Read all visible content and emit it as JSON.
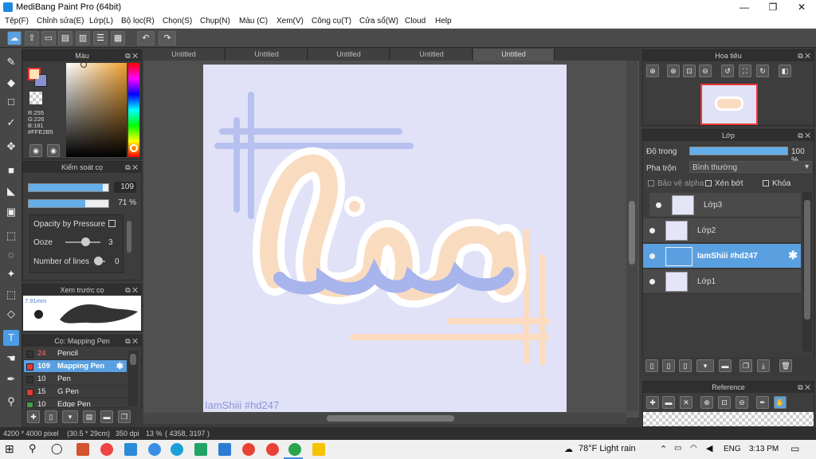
{
  "window": {
    "title": "MediBang Paint Pro (64bit)",
    "min": "—",
    "max": "❐",
    "close": "✕"
  },
  "menu": [
    "Tệp(F)",
    "Chỉnh sửa(E)",
    "Lớp(L)",
    "Bộ lọc(R)",
    "Chọn(S)",
    "Chụp(N)",
    "Màu (C)",
    "Xem(V)",
    "Công cụ(T)",
    "Cửa sổ(W)",
    "Cloud",
    "Help"
  ],
  "tabs": [
    "Untitled",
    "Untitled",
    "Untitled",
    "Untitled",
    "Untitled"
  ],
  "color_panel": {
    "title": "Màu",
    "r": "R:255",
    "g": "G:226",
    "b": "B:181",
    "hex": "#FFE2B5",
    "fg_color": "#ffe2b5",
    "bg_color": "#8a8fd0"
  },
  "brush_control": {
    "title": "Kiểm soát cọ",
    "size_value": "109",
    "opacity_value": "71 %",
    "size_level": 0.93,
    "opacity_level": 0.71,
    "opacity_pressure": "Opacity by Pressure",
    "ooze_label": "Ooze",
    "ooze_value": "3",
    "lines_label": "Number of lines",
    "lines_value": "0"
  },
  "brush_preview": {
    "title": "Xem trước cọ",
    "size": "7.91mm"
  },
  "brush_list": {
    "title": "Cọ: Mapping Pen",
    "items": [
      {
        "num": "24",
        "name": "Pencil",
        "color": "#333333"
      },
      {
        "num": "109",
        "name": "Mapping Pen",
        "color": "#e53935"
      },
      {
        "num": "10",
        "name": "Pen",
        "color": "#333333"
      },
      {
        "num": "15",
        "name": "G Pen",
        "color": "#e53935"
      },
      {
        "num": "10",
        "name": "Edge Pen",
        "color": "#43a047"
      }
    ]
  },
  "navigator": {
    "title": "Hoa tiêu"
  },
  "layers": {
    "title": "Lớp",
    "opacity_label": "Độ trong",
    "opacity_value": "100 %",
    "opacity_level": 1.0,
    "blend_label": "Pha trộn",
    "blend_value": "Bình thường",
    "protect_alpha": "Bảo vệ alpha",
    "clipping": "Xén bớt",
    "lock": "Khóa",
    "items": [
      {
        "name": "Lớp3"
      },
      {
        "name": "Lớp2"
      },
      {
        "name": "IamShiii #hd247"
      },
      {
        "name": "Lớp1"
      }
    ]
  },
  "reference": {
    "title": "Reference"
  },
  "canvas": {
    "watermark": "IamShiii #hd247",
    "art_text": "lisa"
  },
  "status": {
    "size": "4200 * 4000 pixel",
    "cm": "(30.5 * 29cm)",
    "dpi": "350 dpi",
    "zoom": "13 %",
    "coords": "( 4358, 3197 )"
  },
  "taskbar": {
    "weather": "78°F  Light rain",
    "lang": "ENG",
    "time": "3:13 PM"
  }
}
